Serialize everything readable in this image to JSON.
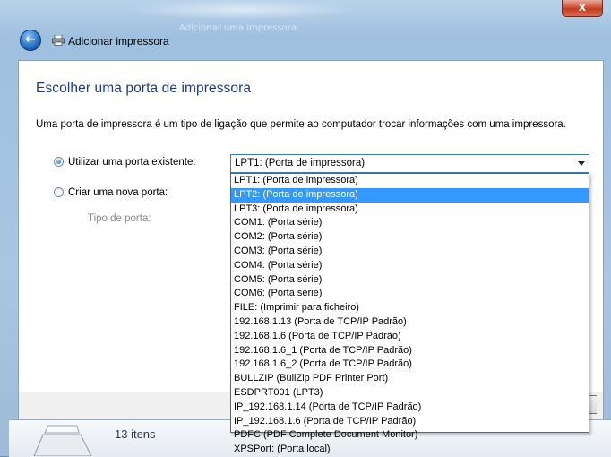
{
  "window": {
    "ghost_title": "Adicionar uma impressora",
    "close_label": "x",
    "title": "Adicionar impressora"
  },
  "page": {
    "heading": "Escolher uma porta de impressora",
    "description": "Uma porta de impressora é um tipo de ligação que permite ao computador trocar informações com uma impressora.",
    "existing_port_label": "Utilizar uma porta existente:",
    "new_port_label": "Criar uma nova porta:",
    "port_type_label": "Tipo de porta:",
    "selected_port": "LPT1: (Porta de impressora)"
  },
  "dropdown": {
    "options": [
      "LPT1: (Porta de impressora)",
      "LPT2: (Porta de impressora)",
      "LPT3: (Porta de impressora)",
      "COM1: (Porta série)",
      "COM2: (Porta série)",
      "COM3: (Porta série)",
      "COM4: (Porta série)",
      "COM5: (Porta série)",
      "COM6: (Porta série)",
      "FILE: (Imprimir para ficheiro)",
      "192.168.1.13 (Porta de TCP/IP Padrão)",
      "192.168.1.6 (Porta de TCP/IP Padrão)",
      "192.168.1.6_1 (Porta de TCP/IP Padrão)",
      "192.168.1.6_2 (Porta de TCP/IP Padrão)",
      "BULLZIP (BullZip PDF Printer Port)",
      "ESDPRT001 (LPT3)",
      "IP_192.168.1.14 (Porta de TCP/IP Padrão)",
      "IP_192.168.1.6 (Porta de TCP/IP Padrão)",
      "PDFC (PDF Complete Document Monitor)",
      "XPSPort: (Porta local)"
    ],
    "highlighted_index": 1
  },
  "background_window": {
    "items_count": "13 itens"
  }
}
